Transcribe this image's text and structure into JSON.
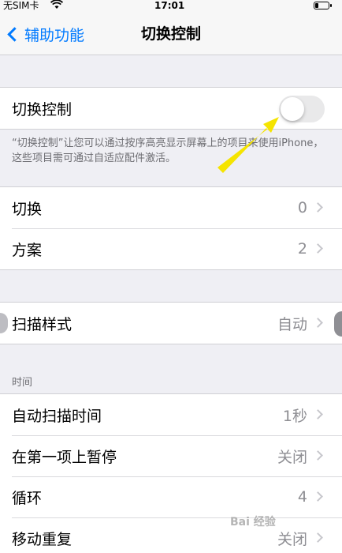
{
  "status_bar": {
    "carrier": "无SIM卡",
    "time": "17:01",
    "wifi_icon": "wifi-icon",
    "battery_icon": "battery-icon"
  },
  "nav": {
    "back_label": "辅助功能",
    "title": "切换控制"
  },
  "switch_control": {
    "label": "切换控制",
    "toggle_on": false,
    "footnote": "“切换控制”让您可以通过按序高亮显示屏幕上的项目来使用iPhone，这些项目需可通过自适应配件激活。"
  },
  "group1": [
    {
      "label": "切换",
      "value": "0"
    },
    {
      "label": "方案",
      "value": "2"
    }
  ],
  "group2": [
    {
      "label": "扫描样式",
      "value": "自动"
    }
  ],
  "section_time": {
    "header": "时间",
    "rows": [
      {
        "label": "自动扫描时间",
        "value": "1秒"
      },
      {
        "label": "在第一项上暂停",
        "value": "关闭"
      },
      {
        "label": "循环",
        "value": "4"
      },
      {
        "label": "移动重复",
        "value": "关闭"
      }
    ]
  },
  "watermark": "Bai 经验",
  "colors": {
    "accent": "#007aff",
    "arrow": "#f5e400"
  }
}
